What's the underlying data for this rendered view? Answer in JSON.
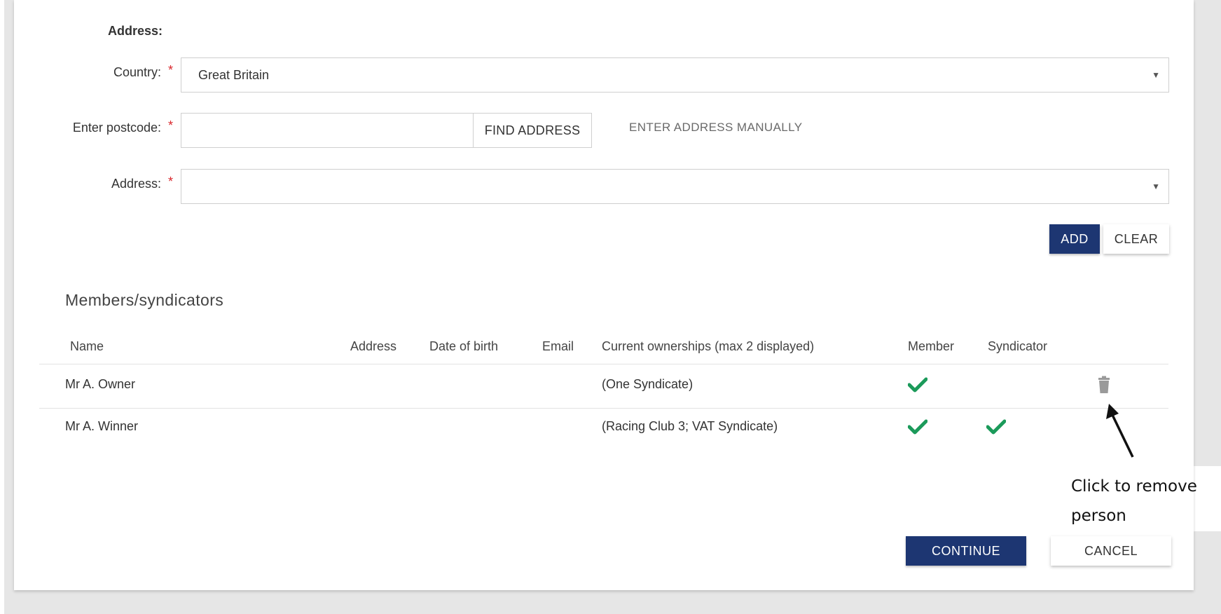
{
  "address_section": {
    "heading": "Address:",
    "country_label": "Country:",
    "country_value": "Great Britain",
    "postcode_label": "Enter postcode:",
    "postcode_value": "",
    "find_address_label": "FIND ADDRESS",
    "enter_manually_label": "ENTER ADDRESS MANUALLY",
    "address_label": "Address:",
    "address_value": "",
    "required_marker": "*",
    "add_label": "ADD",
    "clear_label": "CLEAR"
  },
  "members": {
    "title": "Members/syndicators",
    "columns": [
      "Name",
      "Address",
      "Date of birth",
      "Email",
      "Current ownerships (max 2 displayed)",
      "Member",
      "Syndicator"
    ],
    "rows": [
      {
        "name": "Mr A. Owner",
        "address": "",
        "dob": "",
        "email": "",
        "ownerships": "(One Syndicate)",
        "member": true,
        "syndicator": false,
        "removable": true
      },
      {
        "name": "Mr A. Winner",
        "address": "",
        "dob": "",
        "email": "",
        "ownerships": "(Racing Club 3; VAT Syndicate)",
        "member": true,
        "syndicator": true,
        "removable": false
      }
    ]
  },
  "footer": {
    "continue_label": "CONTINUE",
    "cancel_label": "CANCEL"
  },
  "annotation": {
    "text_line1": "Click to remove",
    "text_line2": "person"
  },
  "icons": {
    "check": "check-icon",
    "trash": "trash-icon",
    "caret": "chevron-down-icon",
    "arrow": "arrow-icon"
  },
  "colors": {
    "primary": "#1d3672",
    "check": "#1b9a5a",
    "required": "#d9262b",
    "trash": "#9a9a9a"
  }
}
